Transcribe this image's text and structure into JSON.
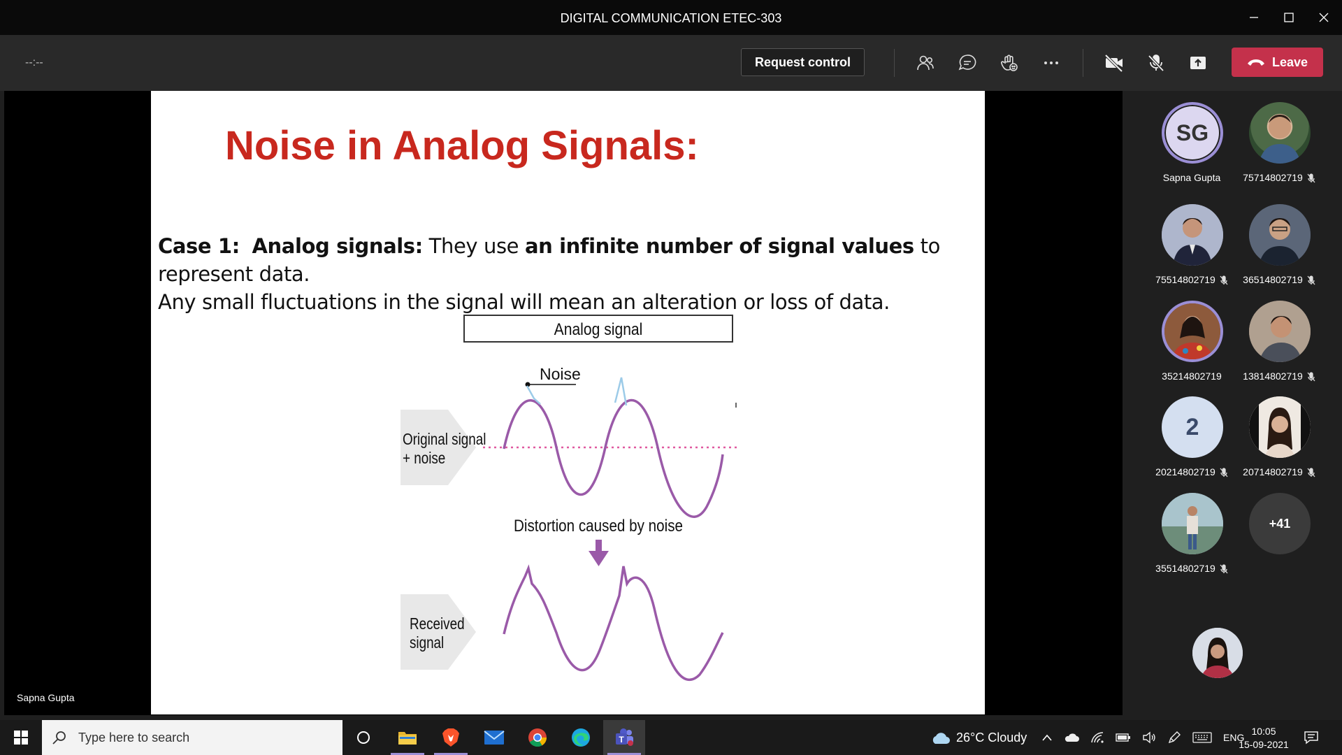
{
  "window": {
    "title": "DIGITAL COMMUNICATION ETEC-303"
  },
  "toolbar": {
    "timer": "--:--",
    "request_control": "Request control",
    "leave": "Leave"
  },
  "slide": {
    "title": "Noise in Analog Signals:",
    "case_label": "Case 1:",
    "term": "Analog signals:",
    "text_a": " They use ",
    "text_b": "an infinite number of signal values",
    "text_c": " to represent data.",
    "line2": " Any small fluctuations in the signal will mean an alteration or loss of data.",
    "figure": {
      "header": "Analog signal",
      "noise": "Noise",
      "label_original_1": "Original signal",
      "label_original_2": "+ noise",
      "distortion": "Distortion caused by noise",
      "label_received_1": "Received",
      "label_received_2": "signal"
    }
  },
  "stage": {
    "presenter_name": "Sapna Gupta"
  },
  "participants": [
    {
      "name": "Sapna Gupta",
      "initials": "SG",
      "muted": false,
      "speaking": true,
      "kind": "initials"
    },
    {
      "name": "75714802719",
      "muted": true,
      "kind": "photo",
      "color": "#5b7a55"
    },
    {
      "name": "75514802719",
      "muted": true,
      "kind": "photo",
      "color": "#6d6f8a"
    },
    {
      "name": "36514802719",
      "muted": true,
      "kind": "photo",
      "color": "#4b5566"
    },
    {
      "name": "35214802719",
      "muted": false,
      "speaking": true,
      "kind": "photo",
      "color": "#7a3e4e"
    },
    {
      "name": "13814802719",
      "muted": true,
      "kind": "photo",
      "color": "#8a7a6a"
    },
    {
      "name": "20214802719",
      "initials": "2",
      "muted": true,
      "kind": "initials"
    },
    {
      "name": "20714802719",
      "muted": true,
      "kind": "photo",
      "color": "#b8a28c"
    },
    {
      "name": "35514802719",
      "muted": true,
      "kind": "photo",
      "color": "#8aa2a8"
    },
    {
      "name": "",
      "initials": "+41",
      "kind": "more"
    }
  ],
  "taskbar": {
    "search_placeholder": "Type here to search",
    "weather": "26°C  Cloudy",
    "lang": "ENG",
    "time": "10:05",
    "date": "15-09-2021"
  },
  "colors": {
    "leave": "#c4314b",
    "accent": "#9b8fd6",
    "slide_title": "#c8281e",
    "signal": "#9a5aa8"
  }
}
